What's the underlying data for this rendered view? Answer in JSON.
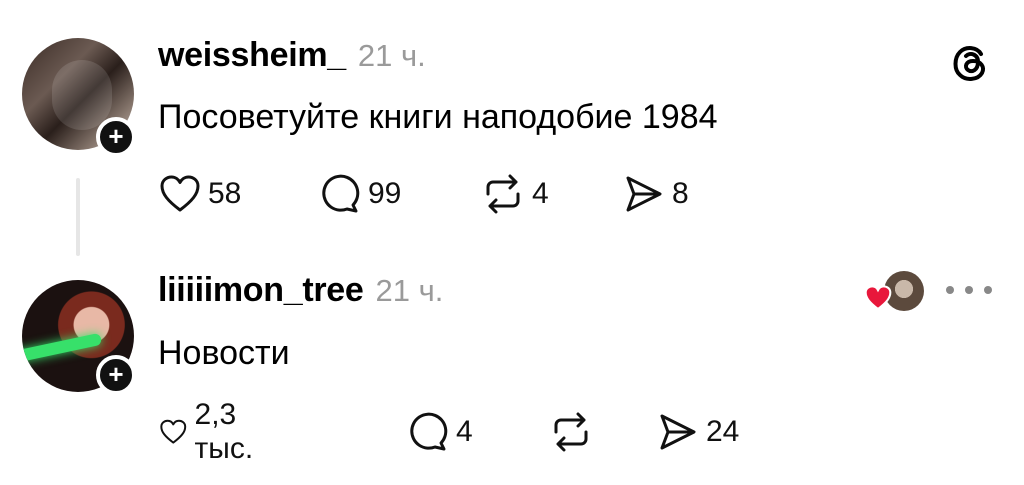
{
  "posts": [
    {
      "username": "weissheim_",
      "time": "21 ч.",
      "text": "Посоветуйте книги наподобие 1984",
      "likes": "58",
      "replies": "99",
      "reposts": "4",
      "shares": "8"
    },
    {
      "username": "liiiiimon_tree",
      "time": "21 ч.",
      "text": "Новости",
      "likes": "2,3 тыс.",
      "replies": "4",
      "reposts": "",
      "shares": "24"
    }
  ],
  "icons": {
    "logo": "threads-logo-icon",
    "like": "heart-icon",
    "reply": "comment-icon",
    "repost": "repost-icon",
    "share": "share-icon",
    "more": "more-icon"
  },
  "colors": {
    "heart_red": "#e8173b",
    "muted": "#9a9a9a",
    "thread_line": "#e6e6e6"
  }
}
